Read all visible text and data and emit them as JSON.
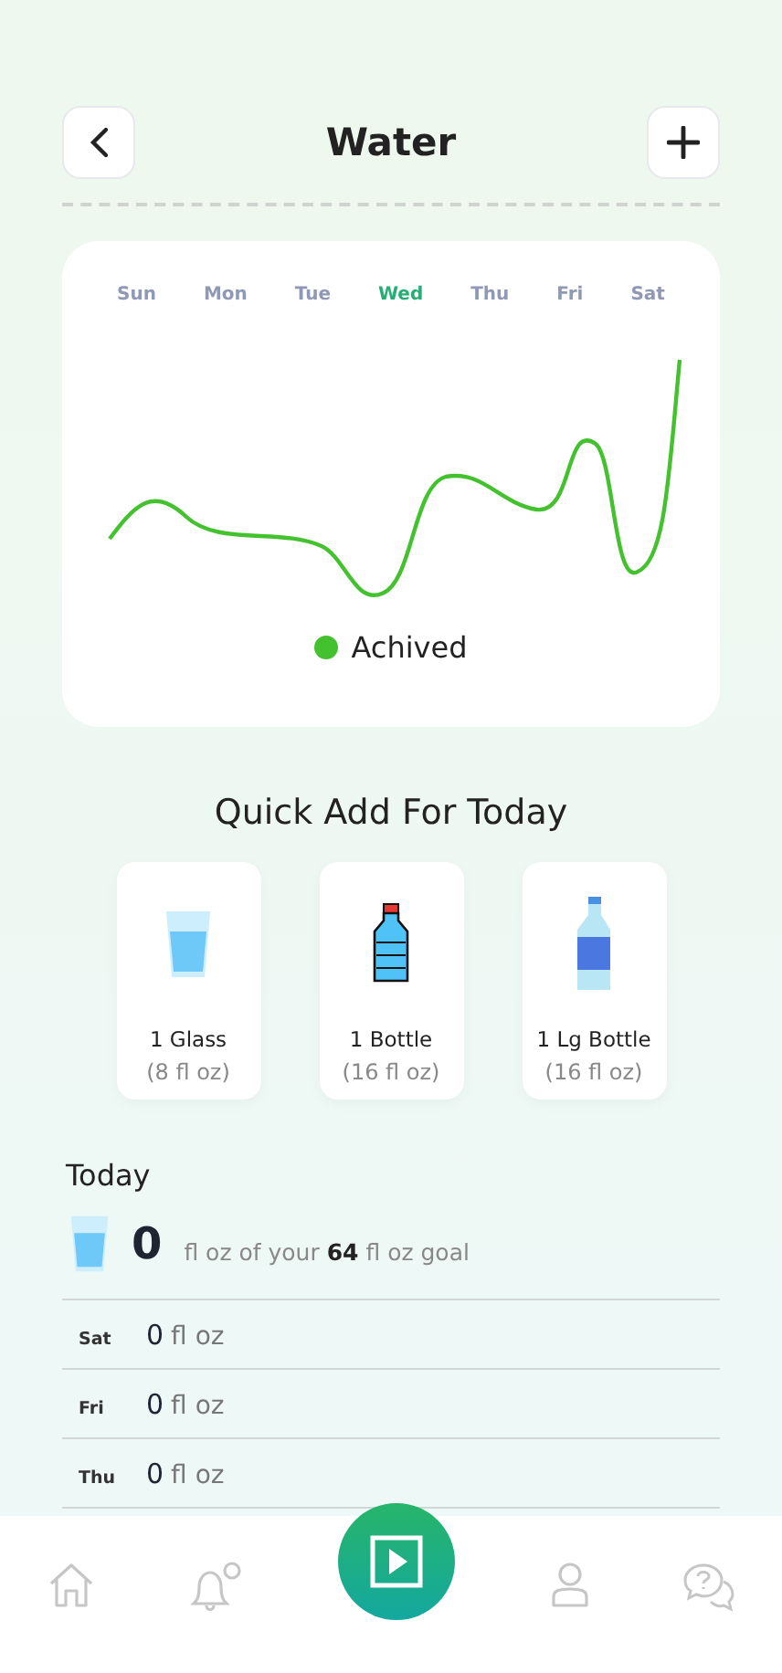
{
  "header": {
    "title": "Water"
  },
  "chart": {
    "days": [
      {
        "label": "Sun",
        "selected": false
      },
      {
        "label": "Mon",
        "selected": false
      },
      {
        "label": "Tue",
        "selected": false
      },
      {
        "label": "Wed",
        "selected": true
      },
      {
        "label": "Thu",
        "selected": false
      },
      {
        "label": "Fri",
        "selected": false
      },
      {
        "label": "Sat",
        "selected": false
      }
    ],
    "legend": {
      "label": "Achived",
      "color": "#44c12e"
    }
  },
  "quick_add": {
    "title": "Quick Add For Today",
    "items": [
      {
        "kind": "glass",
        "name": "1 Glass",
        "amount": "(8 fl oz)"
      },
      {
        "kind": "bottle",
        "name": "1 Bottle",
        "amount": "(16 fl oz)"
      },
      {
        "kind": "large_bottle",
        "name": "1 Lg Bottle",
        "amount": "(16 fl oz)"
      }
    ]
  },
  "today": {
    "title": "Today",
    "amount": "0",
    "goal_text": "fl oz of your **64** fl oz goal",
    "history": [
      {
        "day": "Sat",
        "amount": "0",
        "unit": "fl oz"
      },
      {
        "day": "Fri",
        "amount": "0",
        "unit": "fl oz"
      },
      {
        "day": "Thu",
        "amount": "0",
        "unit": "fl oz"
      }
    ]
  },
  "nav": {
    "items": [
      {
        "kind": "home"
      },
      {
        "kind": "bell"
      },
      {
        "kind": "play"
      },
      {
        "kind": "user"
      },
      {
        "kind": "help"
      }
    ]
  }
}
